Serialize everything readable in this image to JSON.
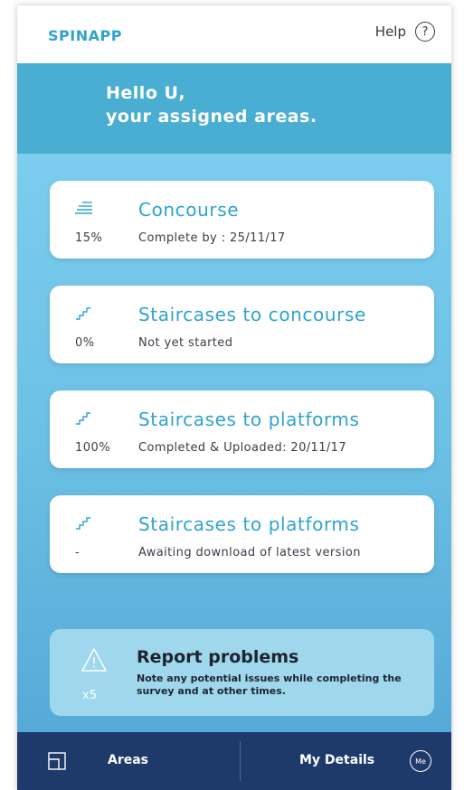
{
  "header": {
    "brand": "SPINAPP",
    "help_label": "Help",
    "help_icon_glyph": "?"
  },
  "greeting": {
    "line1": "Hello U,",
    "line2": "your assigned areas."
  },
  "areas": [
    {
      "icon": "concourse-icon",
      "percent": "15%",
      "title": "Concourse",
      "status": "Complete by : 25/11/17"
    },
    {
      "icon": "staircase-icon",
      "percent": "0%",
      "title": "Staircases to concourse",
      "status": "Not yet started"
    },
    {
      "icon": "staircase-icon",
      "percent": "100%",
      "title": "Staircases to platforms",
      "status": "Completed & Uploaded: 20/11/17"
    },
    {
      "icon": "staircase-icon",
      "percent": "-",
      "title": "Staircases to platforms",
      "status": "Awaiting download of latest version"
    }
  ],
  "report": {
    "icon": "warning-icon",
    "count": "x5",
    "title": "Report problems",
    "description": "Note any potential issues while completing the survey and at other times."
  },
  "nav": {
    "areas_label": "Areas",
    "details_label": "My Details",
    "me_badge": "Me"
  },
  "colors": {
    "brand": "#2fa3cf",
    "greeting_bg": "#4aaed2",
    "content_bg": "#6fc5e6",
    "nav_bg": "#1e3a6b",
    "report_bg": "#9fd7ec"
  }
}
